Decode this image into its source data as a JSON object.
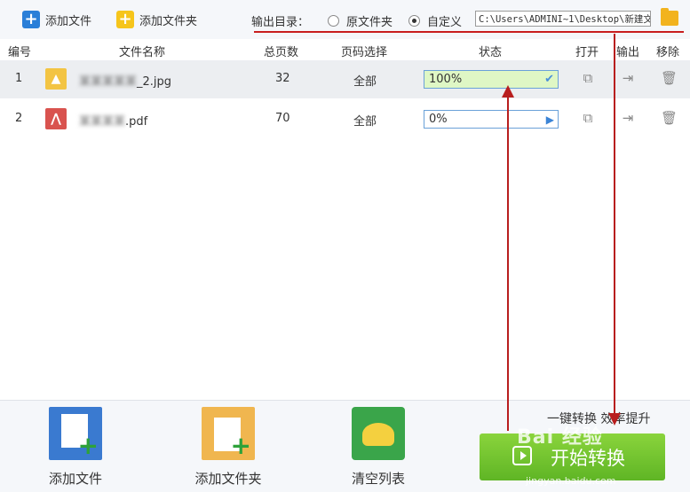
{
  "toolbar": {
    "add_file": "添加文件",
    "add_folder": "添加文件夹",
    "output_label": "输出目录：",
    "option_original": "原文件夹",
    "option_custom": "自定义",
    "output_path": "C:\\Users\\ADMINI~1\\Desktop\\新建文"
  },
  "table": {
    "headers": {
      "index": "编号",
      "filename": "文件名称",
      "pages": "总页数",
      "page_select": "页码选择",
      "status": "状态",
      "open": "打开",
      "output": "输出",
      "remove": "移除"
    },
    "rows": [
      {
        "index": "1",
        "name_blurred": "某某某某某",
        "name_suffix": "_2.jpg",
        "pages": "32",
        "page_select": "全部",
        "status": "100%",
        "progress": 1.0,
        "type": "image"
      },
      {
        "index": "2",
        "name_blurred": "某某某某",
        "name_suffix": ".pdf",
        "pages": "70",
        "page_select": "全部",
        "status": "0%",
        "progress": 0.0,
        "type": "pdf"
      }
    ]
  },
  "bottom": {
    "add_file": "添加文件",
    "add_folder": "添加文件夹",
    "clear_list": "清空列表",
    "slogan": "一键转换  效率提升",
    "start": "开始转换"
  },
  "watermark": {
    "brand": "Bai 经验",
    "url": "jingyan.baidu.com"
  },
  "colors": {
    "accent_red": "#c81e1e",
    "start_green": "#6cc02e",
    "progress_done": "#dff7c5",
    "progress_border": "#6aa1d8"
  }
}
